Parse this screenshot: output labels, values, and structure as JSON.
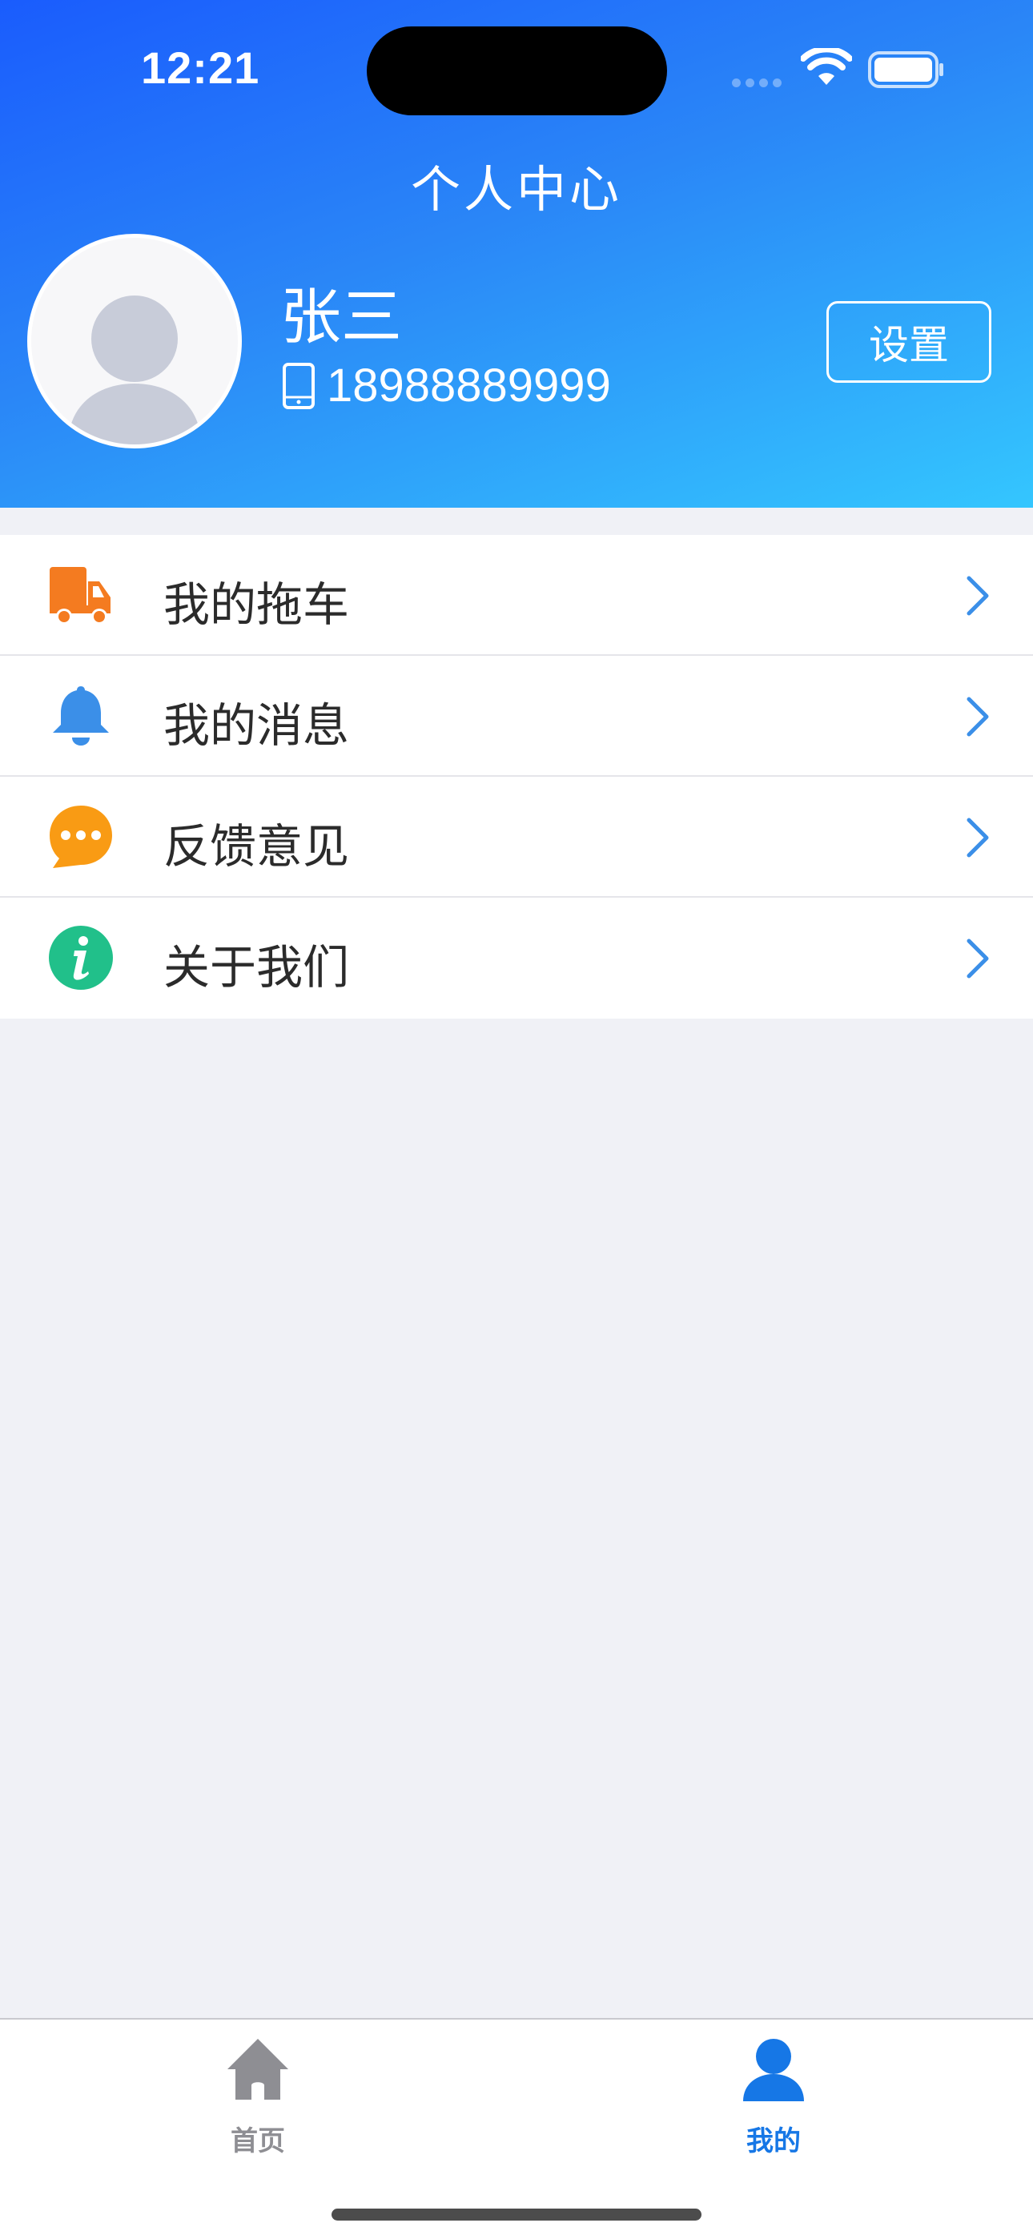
{
  "status_bar": {
    "time": "12:21"
  },
  "header": {
    "title": "个人中心",
    "user_name": "张三",
    "phone": "18988889999",
    "settings_label": "设置"
  },
  "menu": {
    "items": [
      {
        "label": "我的拖车",
        "icon": "truck-icon",
        "color": "#f47b20"
      },
      {
        "label": "我的消息",
        "icon": "bell-icon",
        "color": "#3b8fe8"
      },
      {
        "label": "反馈意见",
        "icon": "chat-bubble-icon",
        "color": "#f99b14"
      },
      {
        "label": "关于我们",
        "icon": "info-icon",
        "color": "#21c08a"
      }
    ]
  },
  "tabbar": {
    "tabs": [
      {
        "label": "首页",
        "icon": "home-icon",
        "active": false,
        "color": "#8e8e93"
      },
      {
        "label": "我的",
        "icon": "person-icon",
        "active": true,
        "color": "#1677e6"
      }
    ]
  },
  "colors": {
    "header_start": "#1a5cfd",
    "header_end": "#34c6fe",
    "background": "#f0f1f6"
  }
}
